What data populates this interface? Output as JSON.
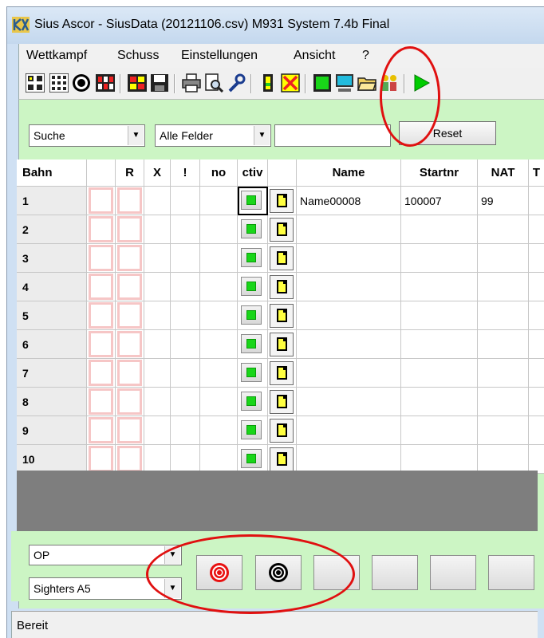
{
  "window": {
    "title": "Sius Ascor - SiusData  (20121106.csv)  M931 System 7.4b Final"
  },
  "menu": [
    "Wettkampf",
    "Schuss",
    "Einstellungen",
    "Ansicht",
    "?"
  ],
  "toolbar": {
    "icons": [
      "grid-4-icon",
      "grid-9-icon",
      "target-icon",
      "color-grid-icon",
      "red-grid-icon",
      "save-icon",
      "print-icon",
      "print-preview-icon",
      "wrench-icon",
      "yellow-bar-icon",
      "stop-icon",
      "green-square-icon",
      "monitor-icon",
      "open-folder-icon",
      "people-icon",
      "play-icon"
    ]
  },
  "filter": {
    "search_mode": "Suche",
    "field_scope": "Alle Felder",
    "search_value": "",
    "reset_label": "Reset"
  },
  "table": {
    "columns": [
      "Bahn",
      "",
      "R",
      "X",
      "!",
      "no",
      "ctiv",
      "",
      "Name",
      "Startnr",
      "NAT",
      "T"
    ],
    "rows": [
      {
        "bahn": "1",
        "name": "Name00008",
        "startnr": "100007",
        "nat": "99"
      },
      {
        "bahn": "2",
        "name": "",
        "startnr": "",
        "nat": ""
      },
      {
        "bahn": "3",
        "name": "",
        "startnr": "",
        "nat": ""
      },
      {
        "bahn": "4",
        "name": "",
        "startnr": "",
        "nat": ""
      },
      {
        "bahn": "5",
        "name": "",
        "startnr": "",
        "nat": ""
      },
      {
        "bahn": "6",
        "name": "",
        "startnr": "",
        "nat": ""
      },
      {
        "bahn": "7",
        "name": "",
        "startnr": "",
        "nat": ""
      },
      {
        "bahn": "8",
        "name": "",
        "startnr": "",
        "nat": ""
      },
      {
        "bahn": "9",
        "name": "",
        "startnr": "",
        "nat": ""
      },
      {
        "bahn": "10",
        "name": "",
        "startnr": "",
        "nat": ""
      }
    ]
  },
  "bottom": {
    "program": "OP",
    "sighters": "Sighters A5"
  },
  "status": {
    "text": "Bereit"
  },
  "colors": {
    "content_bg": "#ccf5c4",
    "active_green": "#19d619",
    "annotation_red": "#e01010"
  }
}
